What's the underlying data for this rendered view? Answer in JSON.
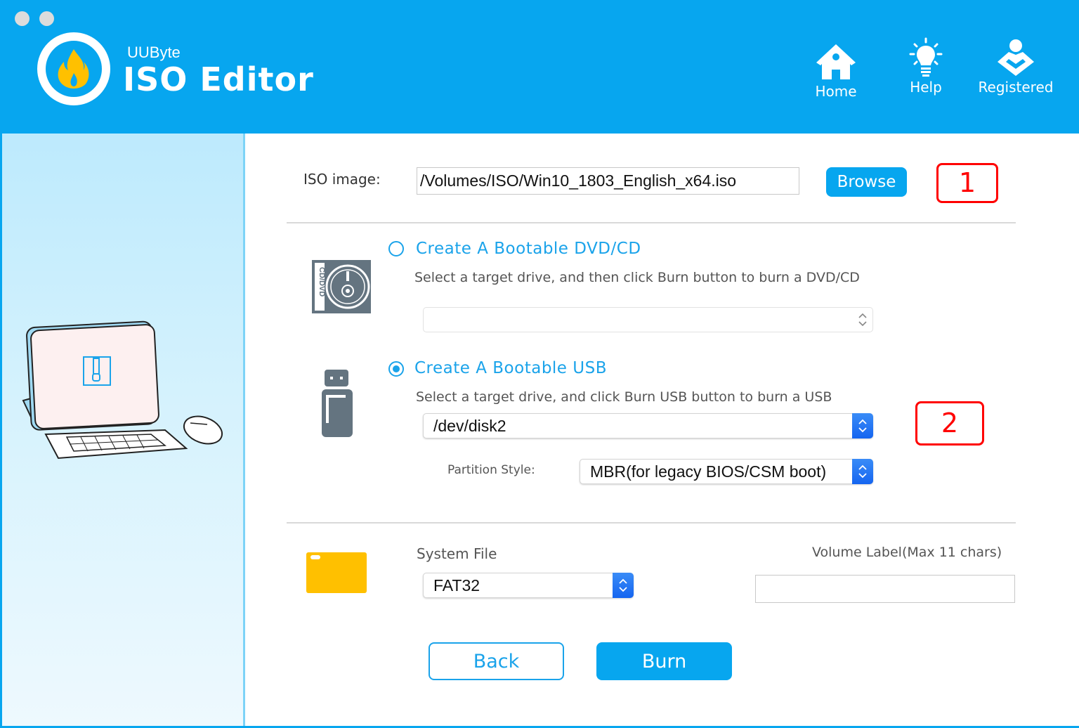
{
  "window": {
    "controls": [
      "close",
      "minimize"
    ]
  },
  "header": {
    "brand_small": "UUByte",
    "brand_title": "ISO Editor",
    "logo_icon": "flame-icon",
    "nav": [
      {
        "label": "Home",
        "icon": "home-icon"
      },
      {
        "label": "Help",
        "icon": "lightbulb-icon"
      },
      {
        "label": "Registered",
        "icon": "registered-user-icon"
      }
    ]
  },
  "sidebar": {
    "illustration": "desktop-computer-with-zip-file-icon"
  },
  "iso": {
    "label": "ISO image:",
    "value": "/Volumes/ISO/Win10_1803_English_x64.iso",
    "browse_label": "Browse"
  },
  "annotations": {
    "step1": "1",
    "step2": "2",
    "color": "#ff0000"
  },
  "dvd_option": {
    "title": "Create A Bootable DVD/CD",
    "description": "Select a target drive, and then click Burn button to burn a DVD/CD",
    "selected": false,
    "drive_value": "",
    "icon": "cd-dvd-icon",
    "icon_text": "CD/DVD"
  },
  "usb_option": {
    "title": "Create A Bootable USB",
    "description": "Select a target drive, and click Burn USB button to burn a USB",
    "selected": true,
    "drive_value": "/dev/disk2",
    "icon": "usb-drive-icon",
    "partition_label": "Partition Style:",
    "partition_value": "MBR(for legacy BIOS/CSM boot)"
  },
  "filesystem": {
    "label": "System File",
    "value": "FAT32",
    "icon": "folder-icon",
    "volume_label": "Volume Label(Max 11 chars)",
    "volume_value": ""
  },
  "actions": {
    "back_label": "Back",
    "burn_label": "Burn"
  },
  "colors": {
    "accent": "#07a6ef",
    "select_caret": "#1a6cf2",
    "folder": "#ffc000",
    "icon_gray": "#647480"
  }
}
